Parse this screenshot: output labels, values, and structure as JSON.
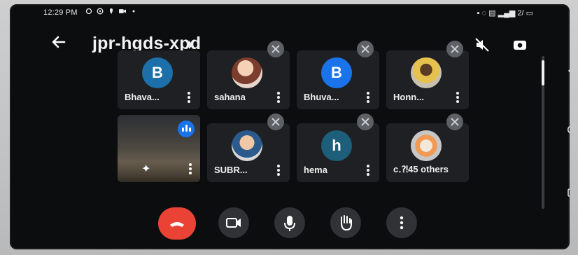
{
  "status_bar": {
    "time": "12:29 PM",
    "right_indicators": "▪ ◌ ▤ ▂▄▆ 2/ ▭"
  },
  "meeting": {
    "code": "jpr-hgds-xpd"
  },
  "participants": [
    {
      "name": "Bhava...",
      "avatar_type": "initial",
      "initial": "B",
      "avatar_color": "#1c6fa8",
      "muted": false
    },
    {
      "name": "sahana",
      "avatar_type": "photo",
      "muted": true
    },
    {
      "name": "Bhuva...",
      "avatar_type": "initial",
      "initial": "B",
      "avatar_color": "#1a73e8",
      "muted": true
    },
    {
      "name": "Honn...",
      "avatar_type": "photo",
      "muted": true
    },
    {
      "name": "",
      "avatar_type": "video",
      "speaking": true
    },
    {
      "name": "SUBR...",
      "avatar_type": "photo",
      "muted": true
    },
    {
      "name": "hema",
      "avatar_type": "initial",
      "initial": "h",
      "avatar_color": "#1d5f7a",
      "muted": true
    },
    {
      "name": "c․⁈45 others",
      "avatar_type": "photo",
      "muted": true
    }
  ],
  "controls": {
    "end_call": "end-call",
    "camera": "camera",
    "microphone": "microphone",
    "raise_hand": "raise-hand",
    "more": "more-options"
  },
  "colors": {
    "screen_bg": "#0c0d0f",
    "tile_bg": "#1f2023",
    "end_call": "#ea4335",
    "speaking": "#1a73e8"
  }
}
